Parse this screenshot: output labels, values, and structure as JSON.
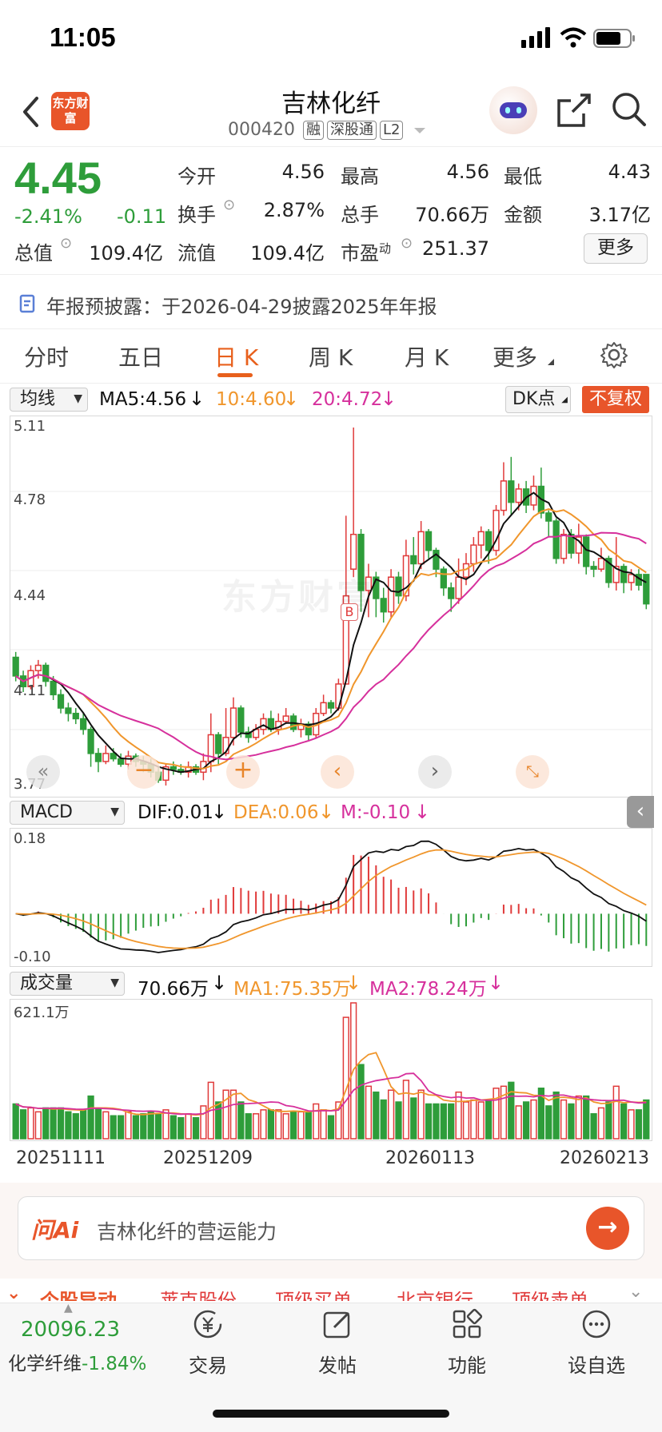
{
  "status_bar": {
    "time": "11:05"
  },
  "header": {
    "title": "吉林化纤",
    "code": "000420",
    "tags": [
      "融",
      "深股通",
      "L2"
    ],
    "logo_text": "东方财富"
  },
  "quote": {
    "price": "4.45",
    "change_pct": "-2.41%",
    "change": "-0.11",
    "fields": [
      {
        "label": "今开",
        "value": "4.56"
      },
      {
        "label": "最高",
        "value": "4.56"
      },
      {
        "label": "最低",
        "value": "4.43"
      },
      {
        "label": "换手",
        "value": "2.87%"
      },
      {
        "label": "总手",
        "value": "70.66万"
      },
      {
        "label": "金额",
        "value": "3.17亿"
      },
      {
        "label": "总值",
        "value": "109.4亿"
      },
      {
        "label": "流值",
        "value": "109.4亿"
      },
      {
        "label": "市盈",
        "sup": "动",
        "value": "251.37"
      }
    ],
    "more_label": "更多"
  },
  "notice": {
    "text": "年报预披露：于2026-04-29披露2025年年报"
  },
  "tabs": [
    {
      "label": "分时"
    },
    {
      "label": "五日"
    },
    {
      "label": "日 K",
      "active": true
    },
    {
      "label": "周 K"
    },
    {
      "label": "月 K"
    },
    {
      "label": "更多"
    }
  ],
  "kline_bar": {
    "dropdown": "均线",
    "ma5": "MA5:4.56",
    "ma10": "10:4.60",
    "ma20": "20:4.72",
    "dk_label": "DK点",
    "adjust_label": "不复权",
    "watermark": "东方财富",
    "buy_marker": "B"
  },
  "macd_bar": {
    "dropdown": "MACD",
    "dif": "DIF:0.01",
    "dea": "DEA:0.06",
    "m": "M:-0.10"
  },
  "vol_bar": {
    "dropdown": "成交量",
    "vol": "70.66万",
    "ma1": "MA1:75.35万",
    "ma2": "MA2:78.24万"
  },
  "chart_data": [
    {
      "type": "candlestick",
      "title": "日K",
      "y_ticks": [
        "5.11",
        "4.78",
        "4.44",
        "4.11",
        "3.77"
      ],
      "ylim": [
        3.77,
        5.11
      ],
      "colors": {
        "up": "#e03a3a",
        "down": "#2e9d3a",
        "ma5": "#111111",
        "ma10": "#f0962c",
        "ma20": "#d6309c"
      },
      "candles": [
        [
          4.25,
          4.18,
          4.27,
          4.16
        ],
        [
          4.18,
          4.14,
          4.2,
          4.12
        ],
        [
          4.14,
          4.2,
          4.22,
          4.13
        ],
        [
          4.2,
          4.22,
          4.24,
          4.17
        ],
        [
          4.22,
          4.16,
          4.23,
          4.14
        ],
        [
          4.16,
          4.11,
          4.18,
          4.09
        ],
        [
          4.11,
          4.06,
          4.13,
          4.04
        ],
        [
          4.06,
          4.04,
          4.08,
          4.01
        ],
        [
          4.04,
          4.02,
          4.06,
          4.0
        ],
        [
          4.02,
          3.98,
          4.04,
          3.96
        ],
        [
          3.98,
          3.89,
          3.99,
          3.84
        ],
        [
          3.89,
          3.86,
          3.91,
          3.82
        ],
        [
          3.86,
          3.89,
          3.92,
          3.85
        ],
        [
          3.89,
          3.87,
          3.91,
          3.86
        ],
        [
          3.87,
          3.85,
          3.89,
          3.84
        ],
        [
          3.85,
          3.88,
          3.9,
          3.83
        ],
        [
          3.88,
          3.86,
          3.89,
          3.84
        ],
        [
          3.86,
          3.85,
          3.88,
          3.82
        ],
        [
          3.85,
          3.82,
          3.87,
          3.8
        ],
        [
          3.82,
          3.79,
          3.84,
          3.78
        ],
        [
          3.79,
          3.84,
          3.85,
          3.77
        ],
        [
          3.84,
          3.83,
          3.86,
          3.81
        ],
        [
          3.83,
          3.82,
          3.85,
          3.81
        ],
        [
          3.82,
          3.84,
          3.86,
          3.8
        ],
        [
          3.84,
          3.82,
          3.85,
          3.81
        ],
        [
          3.82,
          3.86,
          3.89,
          3.79
        ],
        [
          3.86,
          3.96,
          4.04,
          3.82
        ],
        [
          3.96,
          3.89,
          3.97,
          3.85
        ],
        [
          3.89,
          3.95,
          4.06,
          3.88
        ],
        [
          3.95,
          4.06,
          4.1,
          3.92
        ],
        [
          4.06,
          3.97,
          4.07,
          3.95
        ],
        [
          3.97,
          3.95,
          3.99,
          3.93
        ],
        [
          3.95,
          3.98,
          4.0,
          3.94
        ],
        [
          3.98,
          4.02,
          4.04,
          3.96
        ],
        [
          4.02,
          3.98,
          4.05,
          3.97
        ],
        [
          3.98,
          4.01,
          4.04,
          3.96
        ],
        [
          4.01,
          4.03,
          4.06,
          4.0
        ],
        [
          4.03,
          3.98,
          4.04,
          3.97
        ],
        [
          3.98,
          4.0,
          4.02,
          3.95
        ],
        [
          4.0,
          3.96,
          4.01,
          3.94
        ],
        [
          3.96,
          4.04,
          4.06,
          3.95
        ],
        [
          4.04,
          4.08,
          4.11,
          4.03
        ],
        [
          4.08,
          4.06,
          4.09,
          4.04
        ],
        [
          4.06,
          4.15,
          4.17,
          4.05
        ],
        [
          4.15,
          4.48,
          4.78,
          4.23
        ],
        [
          4.58,
          4.71,
          5.11,
          4.55
        ],
        [
          4.71,
          4.5,
          4.73,
          4.42
        ],
        [
          4.5,
          4.55,
          4.6,
          4.4
        ],
        [
          4.55,
          4.47,
          4.57,
          4.4
        ],
        [
          4.47,
          4.42,
          4.51,
          4.38
        ],
        [
          4.42,
          4.55,
          4.58,
          4.4
        ],
        [
          4.55,
          4.48,
          4.57,
          4.45
        ],
        [
          4.48,
          4.63,
          4.69,
          4.46
        ],
        [
          4.63,
          4.6,
          4.7,
          4.56
        ],
        [
          4.6,
          4.72,
          4.76,
          4.58
        ],
        [
          4.72,
          4.65,
          4.73,
          4.62
        ],
        [
          4.65,
          4.58,
          4.66,
          4.55
        ],
        [
          4.58,
          4.51,
          4.59,
          4.48
        ],
        [
          4.51,
          4.47,
          4.53,
          4.42
        ],
        [
          4.47,
          4.55,
          4.62,
          4.45
        ],
        [
          4.55,
          4.6,
          4.64,
          4.52
        ],
        [
          4.6,
          4.67,
          4.7,
          4.57
        ],
        [
          4.67,
          4.72,
          4.74,
          4.62
        ],
        [
          4.72,
          4.65,
          4.73,
          4.6
        ],
        [
          4.65,
          4.8,
          4.82,
          4.63
        ],
        [
          4.8,
          4.91,
          4.98,
          4.78
        ],
        [
          4.91,
          4.83,
          5.0,
          4.78
        ],
        [
          4.83,
          4.88,
          4.9,
          4.8
        ],
        [
          4.88,
          4.82,
          4.91,
          4.79
        ],
        [
          4.82,
          4.89,
          4.93,
          4.8
        ],
        [
          4.89,
          4.79,
          4.96,
          4.77
        ],
        [
          4.79,
          4.76,
          4.8,
          4.7
        ],
        [
          4.76,
          4.62,
          4.77,
          4.6
        ],
        [
          4.62,
          4.71,
          4.73,
          4.6
        ],
        [
          4.71,
          4.64,
          4.73,
          4.62
        ],
        [
          4.64,
          4.7,
          4.75,
          4.6
        ],
        [
          4.7,
          4.59,
          4.71,
          4.56
        ],
        [
          4.59,
          4.58,
          4.61,
          4.55
        ],
        [
          4.58,
          4.62,
          4.66,
          4.57
        ],
        [
          4.62,
          4.53,
          4.63,
          4.51
        ],
        [
          4.53,
          4.59,
          4.7,
          4.5
        ],
        [
          4.59,
          4.53,
          4.6,
          4.49
        ],
        [
          4.53,
          4.56,
          4.58,
          4.5
        ],
        [
          4.56,
          4.52,
          4.58,
          4.5
        ],
        [
          4.56,
          4.45,
          4.56,
          4.43
        ]
      ],
      "candle_order": [
        "open",
        "close",
        "high",
        "low"
      ]
    },
    {
      "type": "bar",
      "title": "MACD",
      "y_ticks": [
        "0.18",
        "-0.10"
      ],
      "ylim": [
        -0.1,
        0.18
      ]
    },
    {
      "type": "bar",
      "title": "成交量",
      "y_ticks": [
        "621.1万"
      ],
      "x_ticks": [
        "20251111",
        "20251209",
        "20260113",
        "20260213"
      ],
      "ylim": [
        0,
        621.1
      ]
    }
  ],
  "ask_ai": {
    "brand": "问Ai",
    "placeholder": "吉林化纤的营运能力"
  },
  "news_ticker": [
    "个股异动",
    "莱克股份",
    "顶级买单",
    "北京银行",
    "顶级卖单"
  ],
  "bottom_bar": {
    "index_value": "20096.23",
    "index_name": "化学纤维",
    "index_change": "-1.84%",
    "items": [
      {
        "label": "交易",
        "icon": "yen-trade-icon"
      },
      {
        "label": "发帖",
        "icon": "compose-icon"
      },
      {
        "label": "功能",
        "icon": "grid-icon"
      },
      {
        "label": "设自选",
        "icon": "more-circle-icon"
      }
    ]
  }
}
